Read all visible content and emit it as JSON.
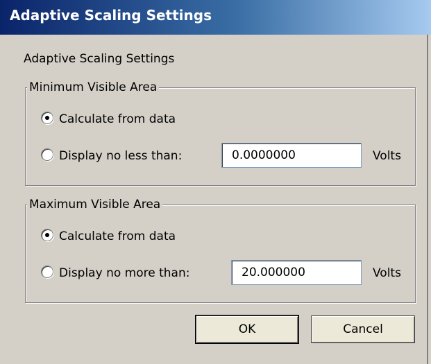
{
  "window": {
    "title": "Adaptive Scaling Settings"
  },
  "caption": "Adaptive Scaling Settings",
  "min_group": {
    "legend": "Minimum Visible Area",
    "option_calc": "Calculate from data",
    "option_display": "Display no less than:",
    "selected": "calculate",
    "value": "0.0000000",
    "unit": "Volts"
  },
  "max_group": {
    "legend": "Maximum Visible Area",
    "option_calc": "Calculate from data",
    "option_display": "Display no more than:",
    "selected": "calculate",
    "value": "20.000000",
    "unit": "Volts"
  },
  "buttons": {
    "ok": "OK",
    "cancel": "Cancel"
  }
}
